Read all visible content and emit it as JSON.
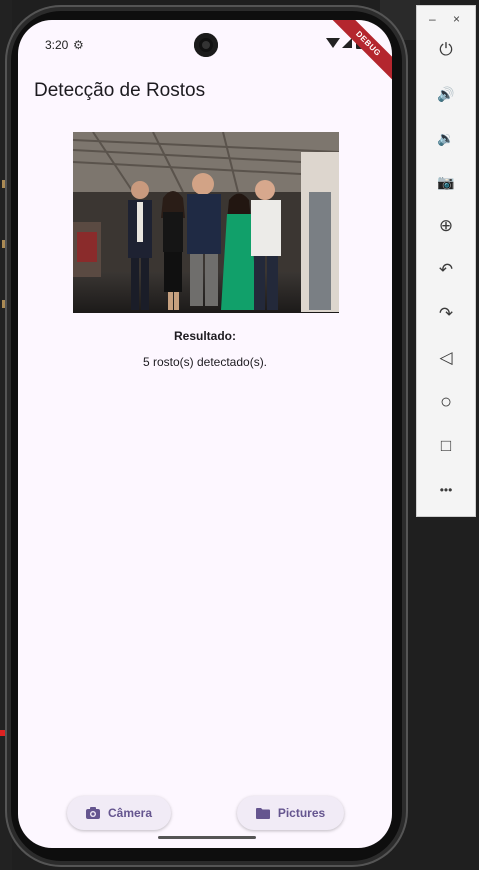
{
  "status_bar": {
    "time": "3:20",
    "debug_banner": "DEBUG"
  },
  "app": {
    "title": "Detecção de Rostos"
  },
  "result": {
    "label": "Resultado:",
    "text": "5 rosto(s) detectado(s)."
  },
  "buttons": {
    "camera_label": "Câmera",
    "pictures_label": "Pictures"
  },
  "colors": {
    "screen_background": "#fdf7ff",
    "accent": "#65558f",
    "button_background": "#f1ebf6",
    "debug_banner": "#b4262e"
  },
  "emulator_toolbar": {
    "window_controls": [
      "–",
      "×"
    ],
    "buttons": [
      {
        "name": "power",
        "glyph": "⏻"
      },
      {
        "name": "volume-up",
        "glyph": "🔊"
      },
      {
        "name": "volume-down",
        "glyph": "🔉"
      },
      {
        "name": "screenshot",
        "glyph": "📷"
      },
      {
        "name": "zoom",
        "glyph": "⊕"
      },
      {
        "name": "rotate-left",
        "glyph": "↶"
      },
      {
        "name": "rotate-right",
        "glyph": "↷"
      },
      {
        "name": "back",
        "glyph": "◁"
      },
      {
        "name": "home",
        "glyph": "○"
      },
      {
        "name": "overview",
        "glyph": "□"
      },
      {
        "name": "more",
        "glyph": "•••"
      }
    ]
  }
}
